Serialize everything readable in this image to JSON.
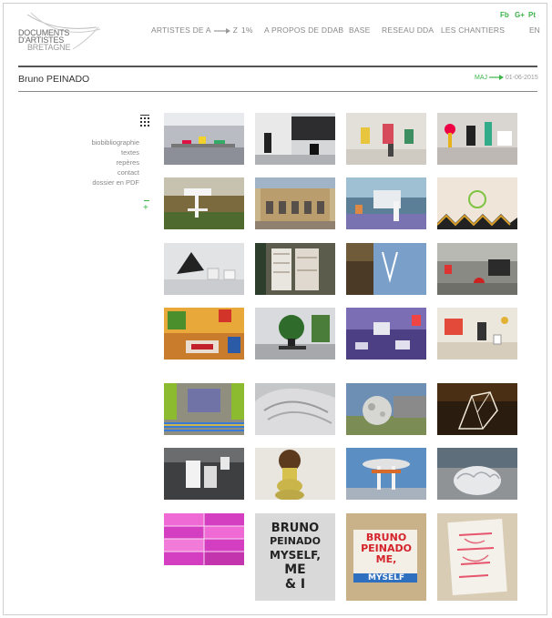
{
  "site": {
    "logo_line1": "DOCUMENTS",
    "logo_line2": "D'ARTISTES",
    "logo_line3": "BRETAGNE"
  },
  "nav": {
    "artists_a": "ARTISTES DE A",
    "artists_z": "Z",
    "one_percent": "1%",
    "about": "A PROPOS DE DDAB",
    "base": "BASE",
    "network": "RESEAU DDA",
    "sites": "LES CHANTIERS"
  },
  "social": {
    "fb": "Fb",
    "gplus": "G+",
    "pt": "Pt"
  },
  "language": "EN",
  "artist": {
    "name": "Bruno PEINADO",
    "maj_label": "MAJ",
    "maj_date": "01-06-2015"
  },
  "sidebar": {
    "items": [
      "biobibliographie",
      "textes",
      "repères",
      "contact",
      "dossier en PDF"
    ],
    "plus_label": "+"
  },
  "posters": {
    "p1": [
      "BRUNO",
      "PEINADO",
      "MYSELF,",
      "ME",
      "& I"
    ],
    "p2": [
      "BRUNO",
      "PEINADO",
      "ME,",
      "MYSELF"
    ]
  },
  "colors": {
    "accent_green": "#3bb54a",
    "rule_dark": "#555555",
    "text_gray": "#888888"
  },
  "icons": {
    "grid_view": "grid-view-icon",
    "arrow": "arrow-right-icon"
  }
}
